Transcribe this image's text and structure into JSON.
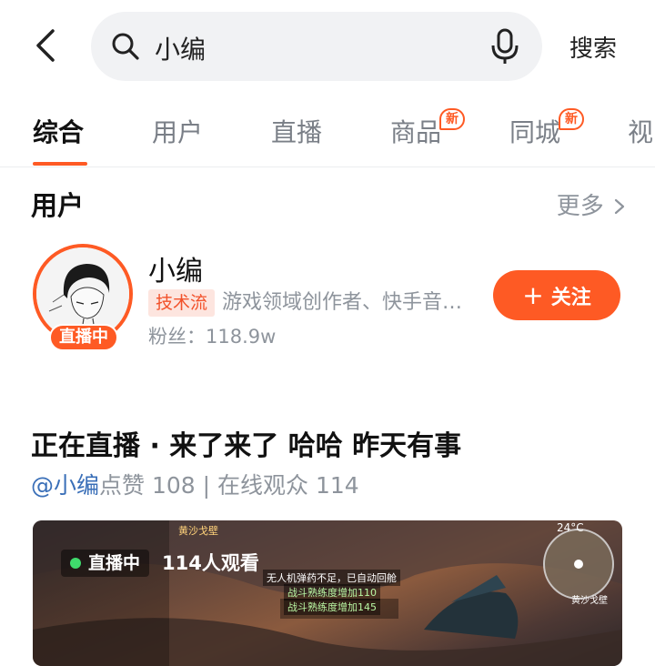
{
  "search": {
    "query": "小编",
    "submit_label": "搜索"
  },
  "tabs": [
    {
      "label": "综合",
      "active": true
    },
    {
      "label": "用户"
    },
    {
      "label": "直播"
    },
    {
      "label": "商品",
      "badge": "新"
    },
    {
      "label": "同城",
      "badge": "新"
    },
    {
      "label": "视"
    }
  ],
  "users_section": {
    "title": "用户",
    "more_label": "更多",
    "user": {
      "name": "小编",
      "live_badge": "直播中",
      "tag": "技术流",
      "description": "游戏领域创作者、快手音…",
      "fans": "粉丝：118.9w",
      "follow_label": "关注"
    }
  },
  "live_card": {
    "title": "正在直播 · 来了来了  哈哈 昨天有事",
    "author": "@小编",
    "stats": "点赞 108 | 在线观众 114",
    "live_label": "直播中",
    "viewers": "114人观看",
    "hud": {
      "location": "黄沙戈壁",
      "temperature": "24°C",
      "msg1": "无人机弹药不足，已自动回舱",
      "msg2": "战斗熟练度增加110",
      "msg3": "战斗熟练度增加145",
      "map_label": "黄沙戈壁"
    }
  },
  "colors": {
    "accent": "#fe5a24",
    "tag_bg": "#fde5df",
    "link": "#3a6fb8"
  }
}
